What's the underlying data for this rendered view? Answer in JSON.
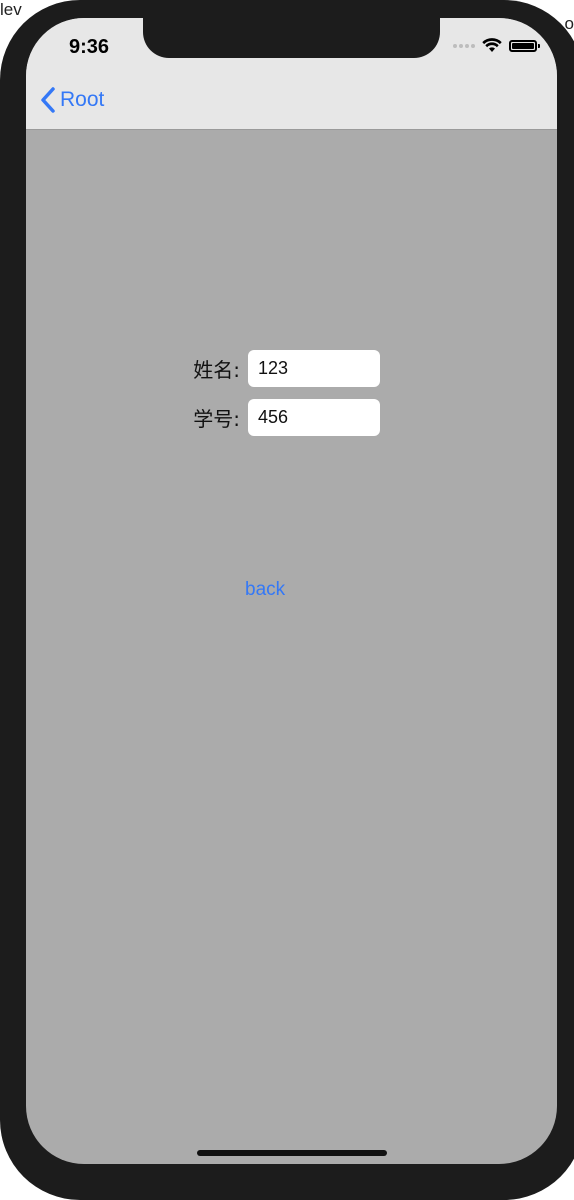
{
  "background": {
    "left_text": "lev",
    "right_text": "o"
  },
  "status_bar": {
    "time": "9:36",
    "icons": [
      "cellular-signal-icon",
      "wifi-icon",
      "battery-icon"
    ]
  },
  "nav_bar": {
    "back_label": "Root",
    "back_icon": "chevron-left-icon"
  },
  "form": {
    "name_label": "姓名:",
    "name_value": "123",
    "id_label": "学号:",
    "id_value": "456"
  },
  "actions": {
    "back_label": "back"
  },
  "colors": {
    "accent": "#3478f6",
    "screen_background": "#ababab",
    "nav_background": "#e7e7e7",
    "device_frame": "#1c1c1c"
  }
}
